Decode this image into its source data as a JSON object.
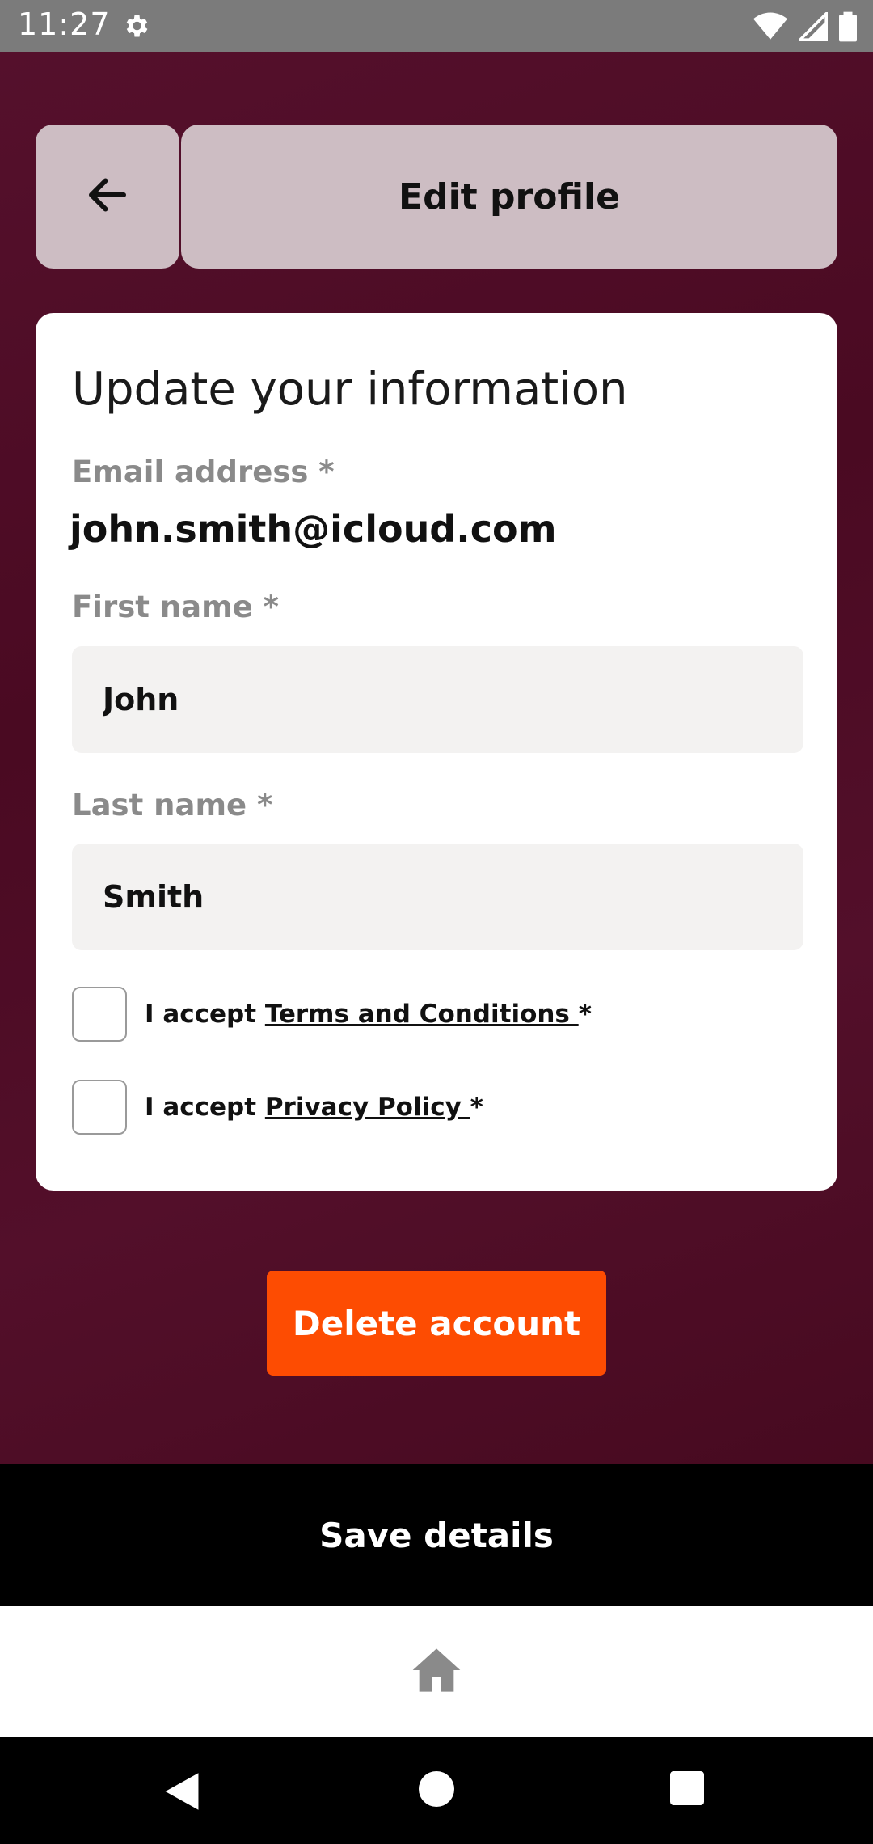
{
  "status_bar": {
    "time": "11:27"
  },
  "header": {
    "title": "Edit profile"
  },
  "form": {
    "heading": "Update your information",
    "email_label": "Email address *",
    "email_value": "john.smith@icloud.com",
    "first_name_label": "First name *",
    "first_name_value": "John",
    "last_name_label": "Last name *",
    "last_name_value": "Smith",
    "terms": {
      "prefix": "I accept ",
      "link": "Terms and Conditions ",
      "suffix": "*"
    },
    "privacy": {
      "prefix": "I accept ",
      "link": "Privacy Policy ",
      "suffix": "*"
    }
  },
  "delete_label": "Delete account",
  "save_label": "Save details",
  "icons": [
    "gear-icon",
    "wifi-icon",
    "signal-icon",
    "battery-icon",
    "back-arrow-icon",
    "home-icon",
    "nav-back-icon",
    "nav-home-icon",
    "nav-recents-icon"
  ],
  "colors": {
    "background": "#4a0b22",
    "accent": "#fd4c02",
    "panel": "#cdbdc3"
  }
}
